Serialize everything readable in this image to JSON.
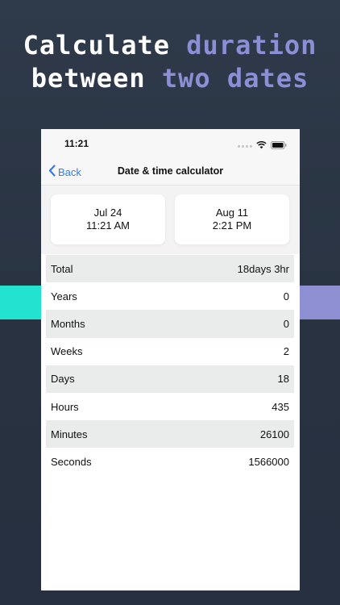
{
  "headline": {
    "line1_prefix": "Calculate",
    "line1_highlight": "duration",
    "line2_prefix": "between",
    "line2_highlight": "two dates"
  },
  "colors": {
    "background": "#2b3545",
    "highlight": "#8d8fd6",
    "stripe_left": "#22e3d0",
    "stripe_right": "#8f8fd3",
    "ios_blue": "#2f7cf6",
    "row_shade": "#eaecec"
  },
  "status_bar": {
    "time": "11:21",
    "icons": [
      "signal-dots-icon",
      "wifi-icon",
      "battery-icon"
    ]
  },
  "navbar": {
    "back_label": "Back",
    "back_icon": "chevron-left-icon",
    "title": "Date & time calculator"
  },
  "dates": {
    "start": {
      "date": "Jul 24",
      "time": "11:21 AM"
    },
    "end": {
      "date": "Aug 11",
      "time": "2:21 PM"
    }
  },
  "results": [
    {
      "label": "Total",
      "value": "18days 3hr"
    },
    {
      "label": "Years",
      "value": "0"
    },
    {
      "label": "Months",
      "value": "0"
    },
    {
      "label": "Weeks",
      "value": "2"
    },
    {
      "label": "Days",
      "value": "18"
    },
    {
      "label": "Hours",
      "value": "435"
    },
    {
      "label": "Minutes",
      "value": "26100"
    },
    {
      "label": "Seconds",
      "value": "1566000"
    }
  ]
}
